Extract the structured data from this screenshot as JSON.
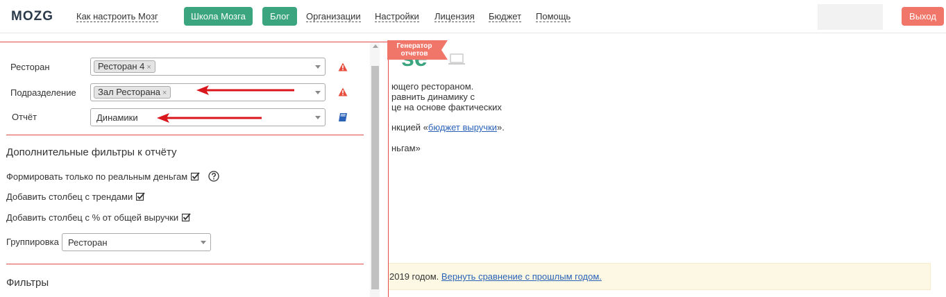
{
  "header": {
    "logo": "MOZG",
    "links": [
      {
        "label": "Как настроить Мозг"
      },
      {
        "label": "Организации"
      },
      {
        "label": "Настройки"
      },
      {
        "label": "Лицензия"
      },
      {
        "label": "Бюджет"
      },
      {
        "label": "Помощь"
      }
    ],
    "school_button": "Школа Мозга",
    "blog_button": "Блог",
    "exit_button": "Выход"
  },
  "background": {
    "big_text": "se",
    "line1": "ющего рестораном.",
    "line2": "равнить динамику с",
    "line3": "це на основе фактических",
    "line4_prefix": "нкцией «",
    "line4_link": "бюджет выручки",
    "line4_suffix": "».",
    "line5": "ньгам»",
    "notice_prefix": "2019 годом. ",
    "notice_link": "Вернуть сравнение с прошлым годом."
  },
  "ribbon": {
    "line1": "Генератор",
    "line2": "отчетов"
  },
  "form": {
    "restaurant_label": "Ресторан",
    "restaurant_tag": "Ресторан 4",
    "division_label": "Подразделение",
    "division_tag": "Зал Ресторана",
    "report_label": "Отчёт",
    "report_value": "Динамики",
    "tag_remove": "×"
  },
  "extra_filters": {
    "title": "Дополнительные фильтры к отчёту",
    "real_money": {
      "label": "Формировать только по реальным деньгам",
      "checked": true
    },
    "trends": {
      "label": "Добавить столбец с трендами",
      "checked": true
    },
    "percent": {
      "label": "Добавить столбец с % от общей выручки",
      "checked": true
    },
    "grouping_label": "Группировка",
    "grouping_value": "Ресторан"
  },
  "filters_title": "Фильтры",
  "colors": {
    "accent_green": "#3aa57e",
    "exit_red": "#f1766a",
    "divider_red": "#e54b4b",
    "arrow_red": "#d9161c",
    "warn_red": "#e74c3c",
    "book_blue": "#2a62b8"
  }
}
